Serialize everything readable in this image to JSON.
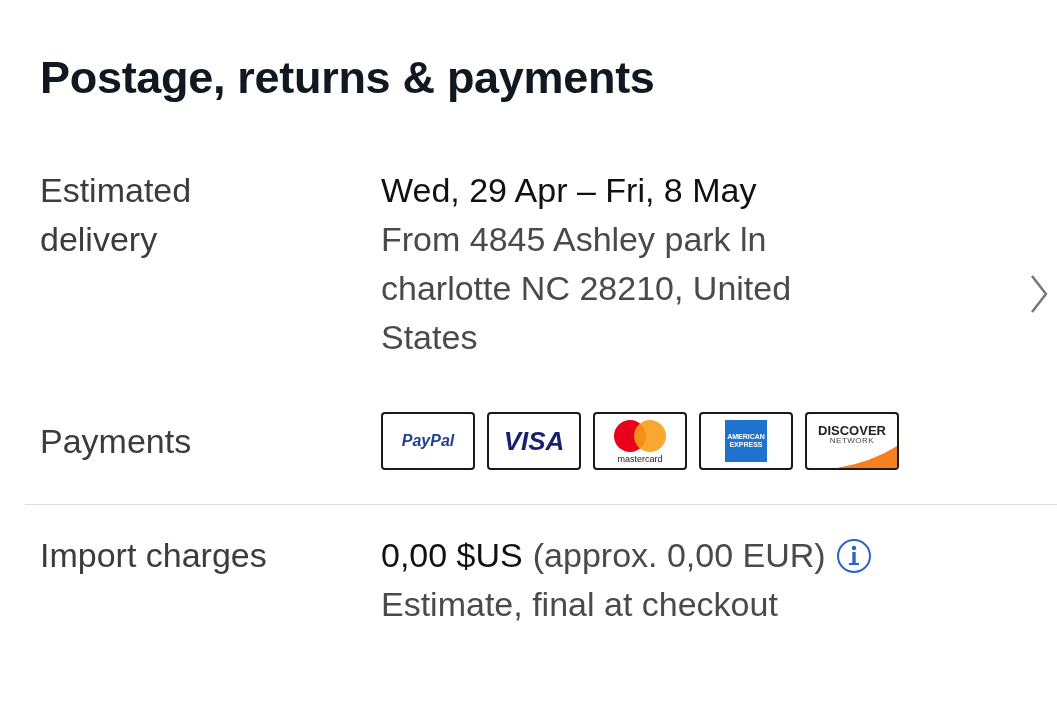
{
  "heading": "Postage, returns & payments",
  "delivery": {
    "label": "Estimated delivery",
    "dates": "Wed, 29 Apr – Fri, 8 May",
    "origin": "From 4845 Ashley park ln charlotte NC 28210, United States"
  },
  "payments": {
    "label": "Payments",
    "methods": [
      {
        "kind": "paypal",
        "text": "PayPal"
      },
      {
        "kind": "visa",
        "text": "VISA"
      },
      {
        "kind": "mastercard",
        "text": "mastercard"
      },
      {
        "kind": "amex",
        "text": "AMERICAN",
        "subtext": "EXPRESS"
      },
      {
        "kind": "discover",
        "text": "DISCOVER",
        "subtext": "NETWORK"
      }
    ]
  },
  "import": {
    "label": "Import charges",
    "amount": "0,00 $US",
    "approx": "(approx. 0,00 EUR)",
    "note": "Estimate, final at checkout"
  }
}
